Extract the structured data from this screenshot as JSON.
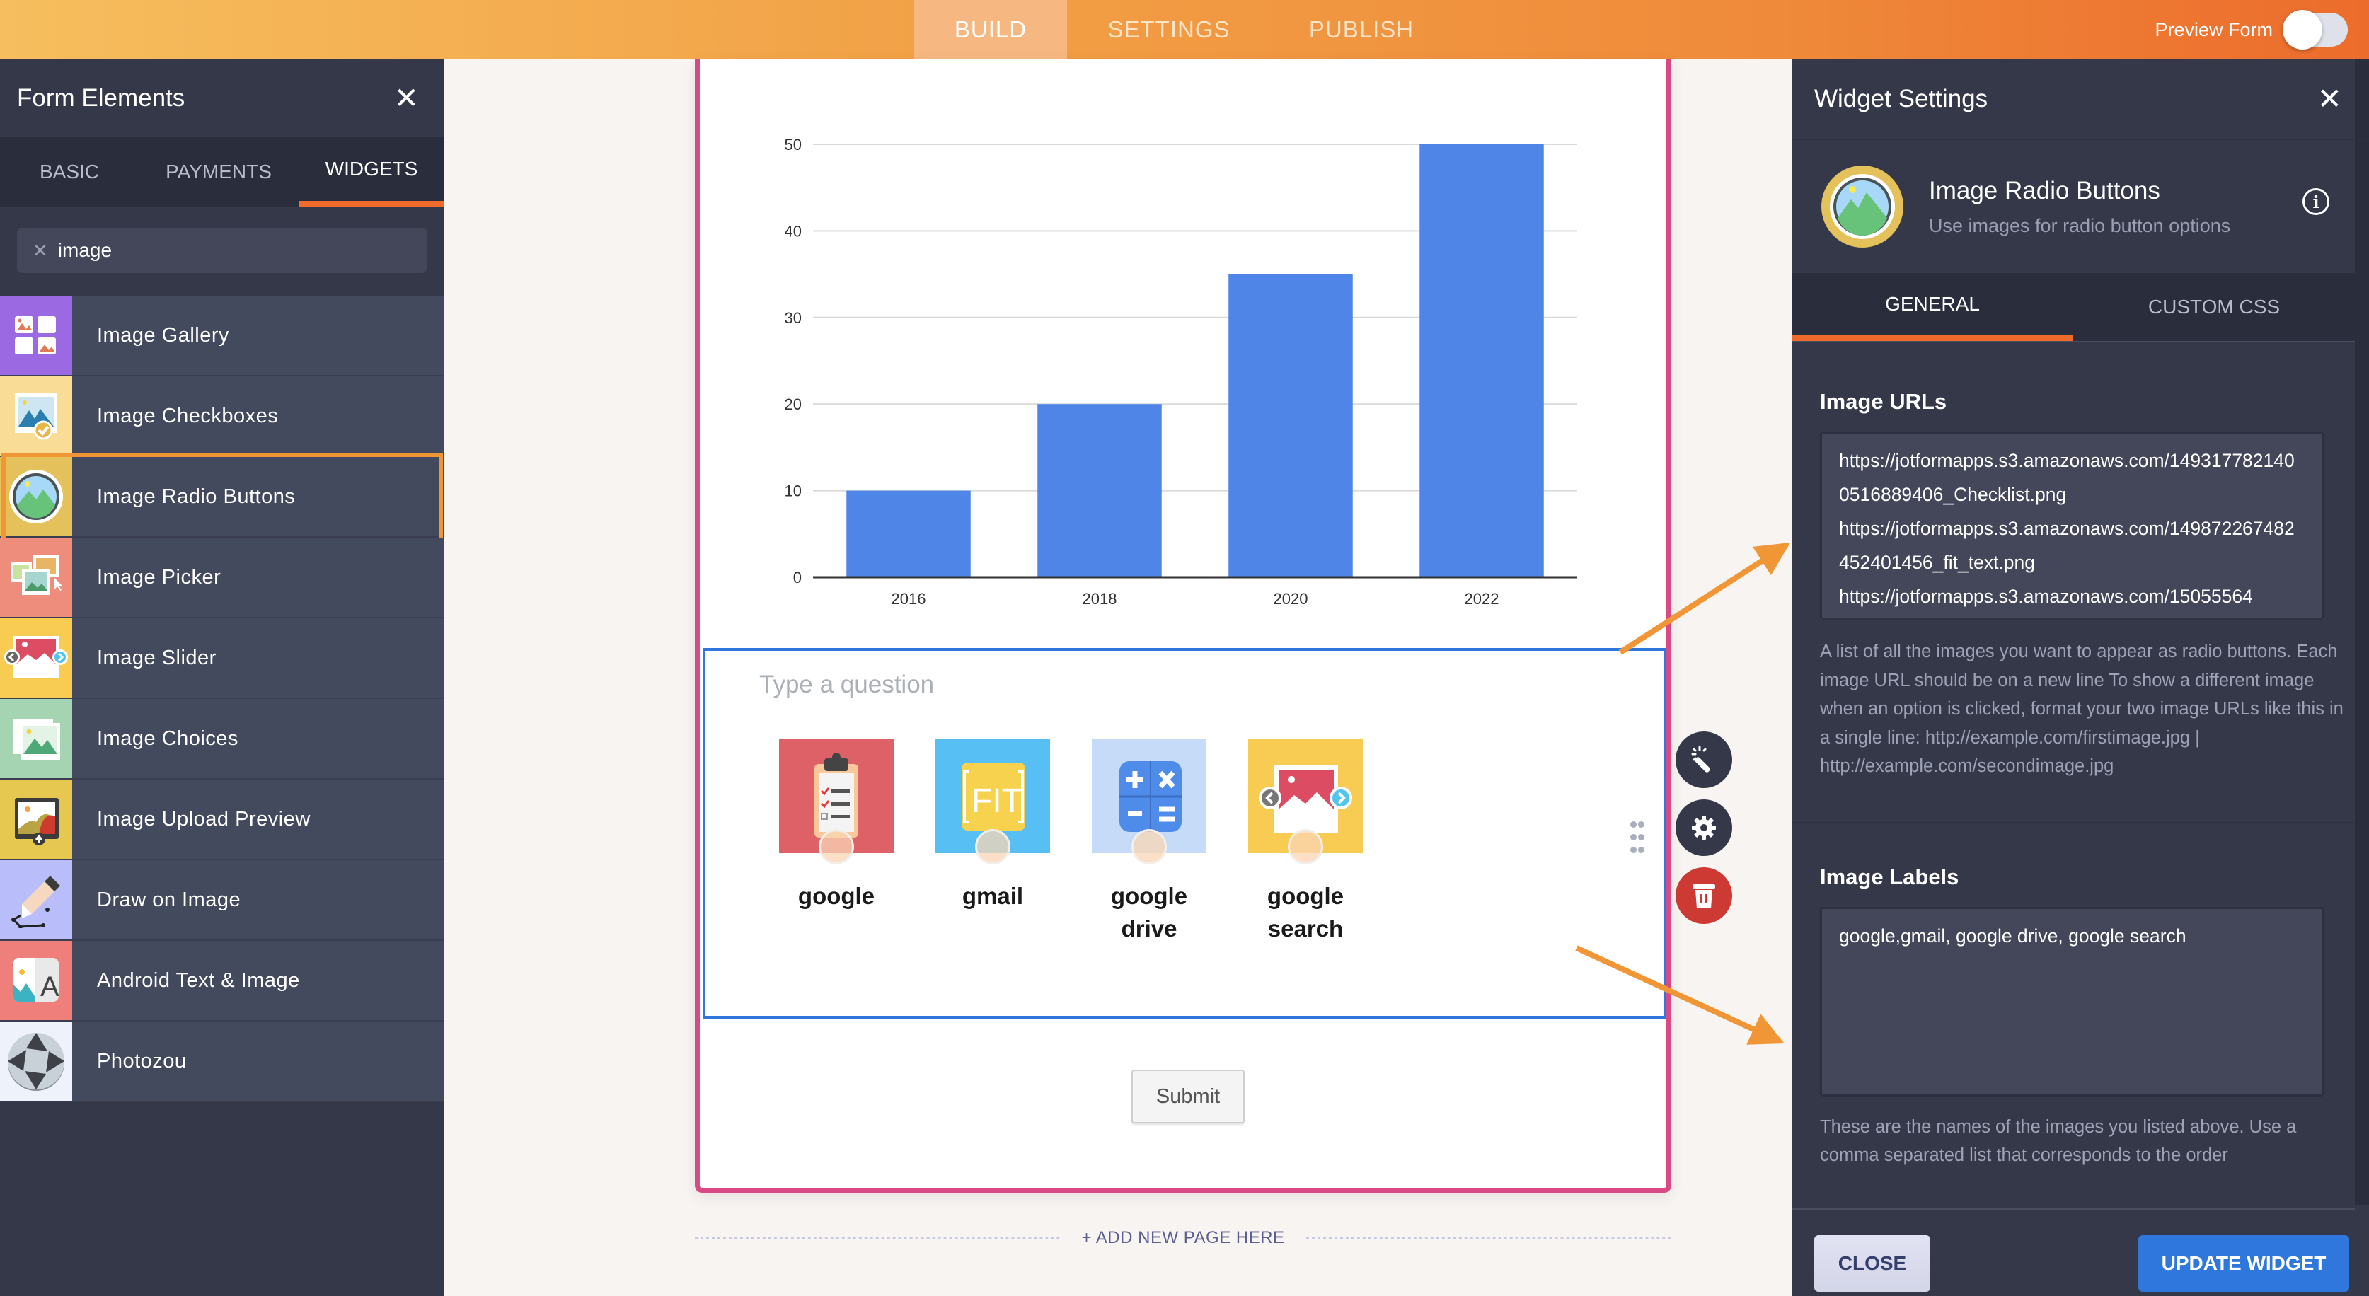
{
  "topbar": {
    "tabs": [
      "BUILD",
      "SETTINGS",
      "PUBLISH"
    ],
    "active_tab": "BUILD",
    "preview_label": "Preview Form",
    "preview_on": false
  },
  "left_panel": {
    "title": "Form Elements",
    "tabs": [
      "BASIC",
      "PAYMENTS",
      "WIDGETS"
    ],
    "active_tab": "WIDGETS",
    "search": {
      "value": "image",
      "clear_icon": "x-icon"
    },
    "items": [
      {
        "label": "Image Gallery",
        "icon": "image-gallery-icon",
        "color": "#9b6ae3"
      },
      {
        "label": "Image Checkboxes",
        "icon": "image-checkboxes-icon",
        "color": "#f9dc95"
      },
      {
        "label": "Image Radio Buttons",
        "icon": "image-radio-buttons-icon",
        "color": "#e4c15a",
        "selected": true
      },
      {
        "label": "Image Picker",
        "icon": "image-picker-icon",
        "color": "#ee8d7b"
      },
      {
        "label": "Image Slider",
        "icon": "image-slider-icon",
        "color": "#f8cb52"
      },
      {
        "label": "Image Choices",
        "icon": "image-choices-icon",
        "color": "#a4d4b1"
      },
      {
        "label": "Image Upload Preview",
        "icon": "image-upload-preview-icon",
        "color": "#e6c750"
      },
      {
        "label": "Draw on Image",
        "icon": "draw-on-image-icon",
        "color": "#b9bdf9"
      },
      {
        "label": "Android Text & Image",
        "icon": "android-text-image-icon",
        "color": "#ef7f7b"
      },
      {
        "label": "Photozou",
        "icon": "photozou-icon",
        "color": "#eef3fb"
      }
    ]
  },
  "chart_data": {
    "type": "bar",
    "categories": [
      "2016",
      "2018",
      "2020",
      "2022"
    ],
    "values": [
      10,
      20,
      35,
      50
    ],
    "title": "",
    "xlabel": "",
    "ylabel": "",
    "ylim": [
      0,
      50
    ],
    "yticks": [
      0,
      10,
      20,
      30,
      40,
      50
    ],
    "grid": true,
    "bar_color": "#5085e8"
  },
  "question": {
    "placeholder": "Type a question",
    "options": [
      {
        "label": "google",
        "image": "checklist-icon",
        "bg": "#dd6167"
      },
      {
        "label": "gmail",
        "image": "fit-text-icon",
        "bg": "#58bff5"
      },
      {
        "label": "google drive",
        "image": "calculator-icon",
        "bg": "#c6dbf7"
      },
      {
        "label": "google search",
        "image": "image-slider-icon",
        "bg": "#f8cb52"
      }
    ]
  },
  "form": {
    "submit_label": "Submit",
    "add_page_label": "+ ADD NEW PAGE HERE"
  },
  "right_panel": {
    "title": "Widget Settings",
    "widget_name": "Image Radio Buttons",
    "widget_desc": "Use images for radio button options",
    "tabs": [
      "GENERAL",
      "CUSTOM CSS"
    ],
    "active_tab": "GENERAL",
    "image_urls": {
      "label": "Image URLs",
      "value": "https://jotformapps.s3.amazonaws.com/1493177821400516889406_Checklist.png\nhttps://jotformapps.s3.amazonaws.com/149872267482452401456_fit_text.png\nhttps://jotformapps.s3.amazonaws.com/15055564",
      "help": "A list of all the images you want to appear as radio buttons. Each image URL should be on a new line To show a different image when an option is clicked, format your two image URLs like this in a single line: http://example.com/firstimage.jpg | http://example.com/secondimage.jpg"
    },
    "image_labels": {
      "label": "Image Labels",
      "value": "google,gmail, google drive, google search",
      "help": "These are the names of the images you listed above. Use a comma separated list that corresponds to the order"
    },
    "close_label": "CLOSE",
    "update_label": "UPDATE WIDGET"
  },
  "colors": {
    "accent_orange": "#ef6b2c",
    "panel_dark": "#343849",
    "form_border": "#d94a84",
    "selection_blue": "#2f77dd",
    "delete_red": "#cc3a33"
  }
}
